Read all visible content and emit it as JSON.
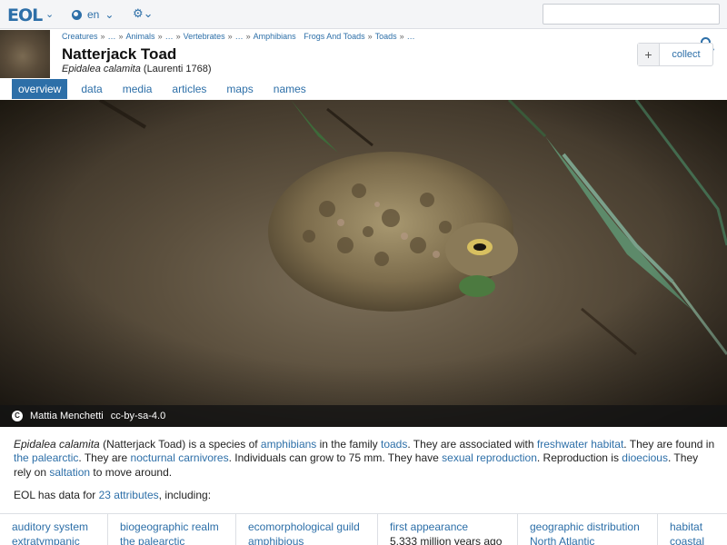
{
  "nav": {
    "logo": "EOL",
    "language": "en"
  },
  "header": {
    "breadcrumbs": [
      "Creatures",
      "…",
      "Animals",
      "…",
      "Vertebrates",
      "…",
      "Amphibians",
      "Frogs And Toads",
      "Toads",
      "…"
    ],
    "title": "Natterjack Toad",
    "scientific_name": "Epidalea calamita",
    "authority": "(Laurenti 1768)",
    "collect_label": "collect"
  },
  "tabs": [
    "overview",
    "data",
    "media",
    "articles",
    "maps",
    "names"
  ],
  "active_tab": "overview",
  "image": {
    "attribution": "Mattia Menchetti",
    "license": "cc-by-sa-4.0"
  },
  "summary": {
    "name_sci": "Epidalea calamita",
    "p1": " (Natterjack Toad) is a species of ",
    "link_amphibians": "amphibians",
    "p2": " in the family ",
    "link_toads": "toads",
    "p3": ". They are associated with ",
    "link_freshwater": "freshwater habitat",
    "p4": ". They are found in ",
    "link_palearctic": "the palearctic",
    "p5": ". They are ",
    "link_nocturnal": "nocturnal",
    "p6": " ",
    "link_carnivores": "carnivores",
    "p7": ". Individuals can grow to 75 mm. They have ",
    "link_sexual": "sexual reproduction",
    "p8": ". Reproduction is ",
    "link_dioecious": "dioecious",
    "p9": ". They rely on ",
    "link_saltation": "saltation",
    "p10": " to move around."
  },
  "data_for": {
    "prefix": "EOL has data for ",
    "link": "23 attributes",
    "suffix": ", including:"
  },
  "attributes": [
    {
      "name": "auditory system",
      "value": "extratympanic"
    },
    {
      "name": "biogeographic realm",
      "value": "the palearctic"
    },
    {
      "name": "ecomorphological guild",
      "value": "amphibious"
    },
    {
      "name": "first appearance",
      "value": "5.333 million years ago"
    },
    {
      "name": "geographic distribution",
      "value": "North Atlantic"
    },
    {
      "name": "habitat",
      "value": "coastal"
    }
  ],
  "colors": {
    "accent": "#2d6fa8",
    "topbar_bg": "#f4f5f7"
  }
}
